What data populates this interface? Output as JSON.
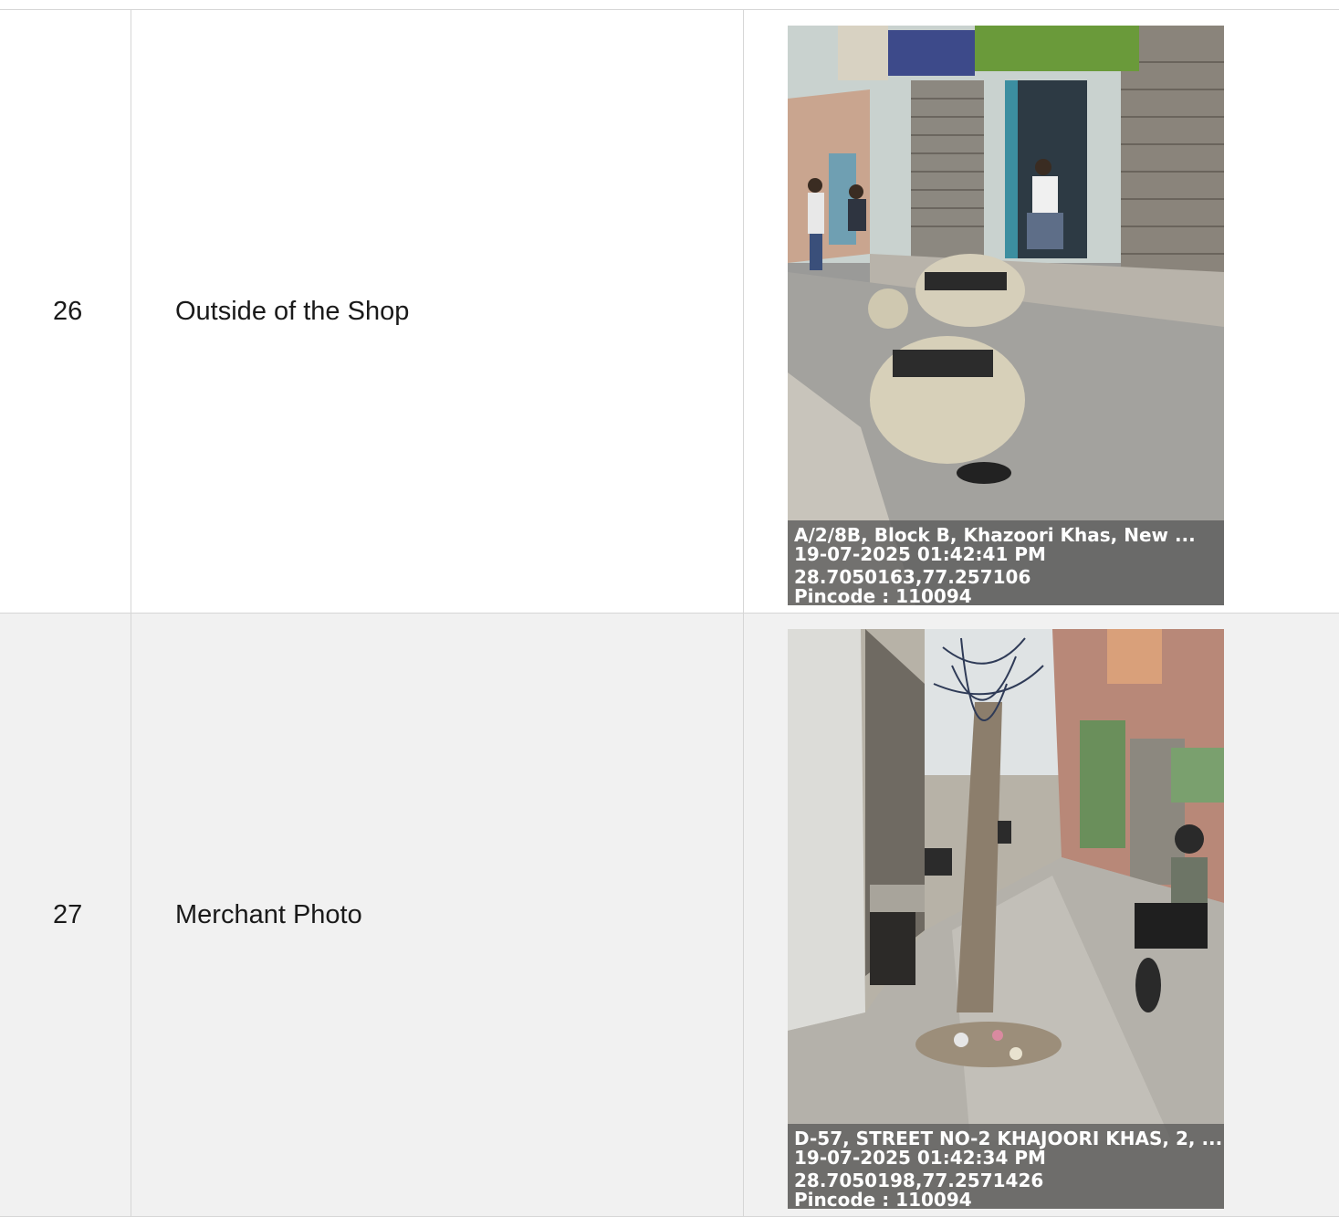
{
  "rows": [
    {
      "number": "26",
      "label": "Outside of the Shop",
      "photo": {
        "address": "A/2/8B, Block B, Khazoori Khas, New ...",
        "timestamp": "19-07-2025 01:42:41 PM",
        "coordinates": "28.7050163,77.257106",
        "pincode": "Pincode : 110094"
      }
    },
    {
      "number": "27",
      "label": "Merchant Photo",
      "photo": {
        "address": "D-57, STREET NO-2 KHAJOORI KHAS, 2, ...",
        "timestamp": "19-07-2025 01:42:34 PM",
        "coordinates": "28.7050198,77.2571426",
        "pincode": "Pincode : 110094"
      }
    }
  ],
  "colors": {
    "border": "#d6d6d6",
    "row_alt_background": "#f1f1f1",
    "caption_overlay": "#5a5a5a"
  }
}
